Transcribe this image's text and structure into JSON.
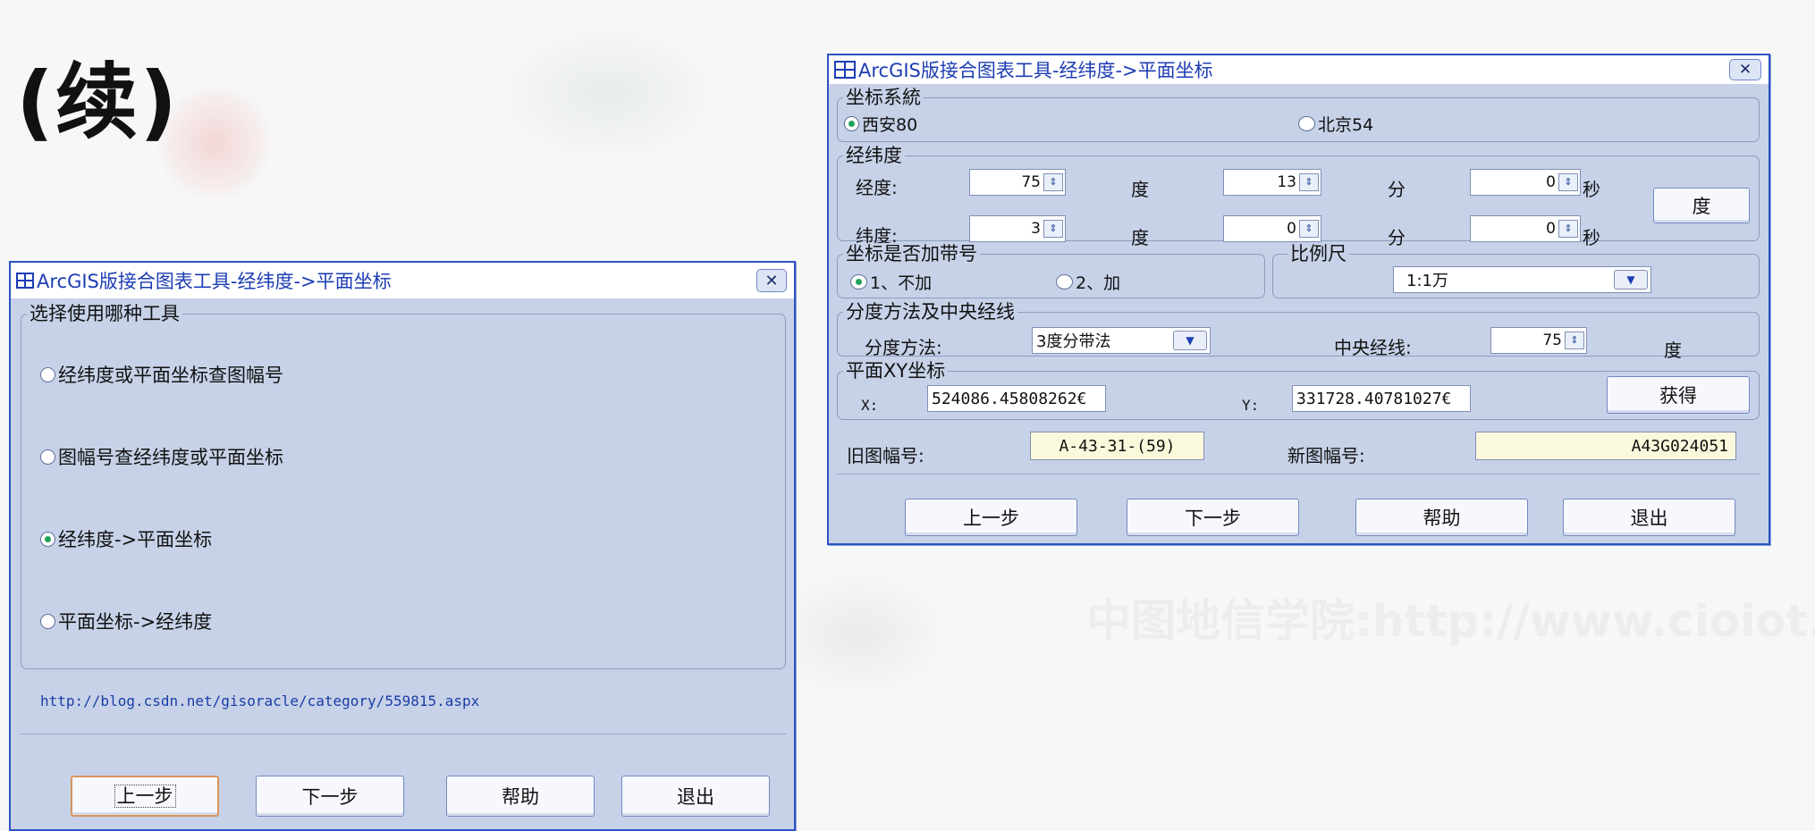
{
  "slide": {
    "title": "(续)",
    "watermark": "中图地信学院:http://www.cioiot.cn"
  },
  "dialog_left": {
    "title": "ArcGIS版接合图表工具-经纬度->平面坐标",
    "group_label": "选择使用哪种工具",
    "options": [
      {
        "label": "经纬度或平面坐标查图幅号",
        "selected": false
      },
      {
        "label": "图幅号查经纬度或平面坐标",
        "selected": false
      },
      {
        "label": "经纬度->平面坐标",
        "selected": true
      },
      {
        "label": "平面坐标->经纬度",
        "selected": false
      }
    ],
    "link": "http://blog.csdn.net/gisoracle/category/559815.aspx",
    "buttons": {
      "prev": "上一步",
      "next": "下一步",
      "help": "帮助",
      "exit": "退出"
    }
  },
  "dialog_right": {
    "title": "ArcGIS版接合图表工具-经纬度->平面坐标",
    "coord_system": {
      "label": "坐标系統",
      "options": [
        {
          "label": "西安80",
          "selected": true
        },
        {
          "label": "北京54",
          "selected": false
        }
      ]
    },
    "latlon": {
      "label": "经纬度",
      "lon_label": "经度:",
      "lat_label": "纬度:",
      "deg_unit": "度",
      "min_unit": "分",
      "sec_unit": "秒",
      "lon": {
        "deg": "75",
        "min": "13",
        "sec": "0"
      },
      "lat": {
        "deg": "3",
        "min": "0",
        "sec": "0"
      },
      "deg_button": "度"
    },
    "zone": {
      "label": "坐标是否加带号",
      "options": [
        {
          "label": "1、不加",
          "selected": true
        },
        {
          "label": "2、加",
          "selected": false
        }
      ]
    },
    "scale": {
      "label": "比例尺",
      "value": "1:1万"
    },
    "division": {
      "label": "分度方法及中央经线",
      "method_label": "分度方法:",
      "method_value": "3度分带法",
      "central_label": "中央经线:",
      "central_value": "75",
      "central_unit": "度"
    },
    "xy": {
      "label": "平面XY坐标",
      "x_label": "X:",
      "x_value": "524086.45808262€",
      "y_label": "Y:",
      "y_value": "331728.40781027€",
      "get_button": "获得"
    },
    "sheet": {
      "old_label": "旧图幅号:",
      "old_value": "A-43-31-(59)",
      "new_label": "新图幅号:",
      "new_value": "A43G024051"
    },
    "buttons": {
      "prev": "上一步",
      "next": "下一步",
      "help": "帮助",
      "exit": "退出"
    }
  }
}
